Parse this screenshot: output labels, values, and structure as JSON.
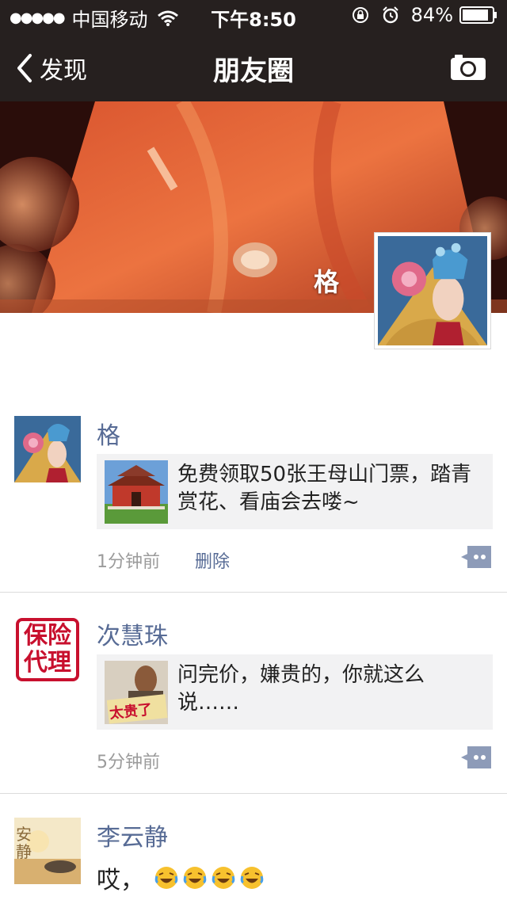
{
  "status_bar": {
    "signal": "●●●●●",
    "carrier": "中国移动",
    "time": "下午8:50",
    "battery": "84%"
  },
  "nav": {
    "back_label": "发现",
    "title": "朋友圈",
    "camera_icon": "camera-icon"
  },
  "cover": {
    "username": "格"
  },
  "posts": [
    {
      "name": "格",
      "link_title": "免费领取50张王母山门票，踏青赏花、看庙会去喽~",
      "time": "1分钟前",
      "delete": "删除"
    },
    {
      "name": "次慧珠",
      "avatar_text_top": "保险",
      "avatar_text_bottom": "代理",
      "link_title": "问完价，嫌贵的，你就这么说……",
      "thumb_text": "太贵了",
      "time": "5分钟前"
    },
    {
      "name": "李云静",
      "text": "哎，",
      "avatar_text": "安静",
      "emojis": [
        "laugh-cry-icon",
        "laugh-cry-icon",
        "laugh-cry-icon",
        "laugh-cry-icon"
      ]
    }
  ],
  "colors": {
    "name_blue": "#576b95",
    "topbar": "#26201f",
    "card_bg": "#f2f2f3",
    "comment_button": "#8d9bb8"
  }
}
